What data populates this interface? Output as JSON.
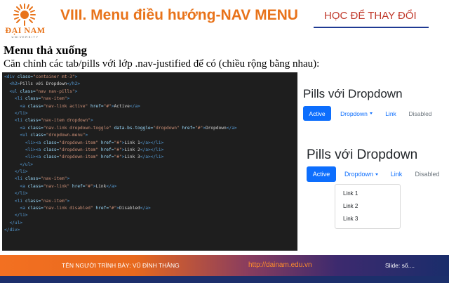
{
  "header": {
    "logo_name": "ĐẠI NAM",
    "logo_sub": "UNIVERSITY",
    "title": "VIII. Menu điều hướng-NAV MENU",
    "right_text": "HỌC ĐỂ THAY ĐỔI"
  },
  "content": {
    "heading": "Menu thả xuống",
    "description": "Căn chỉnh các tab/pills với lớp .nav-justified để có (chiều rộng bằng nhau):"
  },
  "code_lines": [
    [
      [
        "tag",
        "<div "
      ],
      [
        "attr",
        "class="
      ],
      [
        "str",
        "\"container mt-3\""
      ],
      [
        "tag",
        ">"
      ]
    ],
    [
      [
        "txt",
        "  "
      ],
      [
        "tag",
        "<h2>"
      ],
      [
        "txt",
        "Pills với Dropdown"
      ],
      [
        "tag",
        "</h2>"
      ]
    ],
    [
      [
        "txt",
        "  "
      ],
      [
        "tag",
        "<ul "
      ],
      [
        "attr",
        "class="
      ],
      [
        "str",
        "\"nav nav-pills\""
      ],
      [
        "tag",
        ">"
      ]
    ],
    [
      [
        "txt",
        "    "
      ],
      [
        "tag",
        "<li "
      ],
      [
        "attr",
        "class="
      ],
      [
        "str",
        "\"nav-item\""
      ],
      [
        "tag",
        ">"
      ]
    ],
    [
      [
        "txt",
        "      "
      ],
      [
        "tag",
        "<a "
      ],
      [
        "attr",
        "class="
      ],
      [
        "str",
        "\"nav-link active\" "
      ],
      [
        "attr",
        "href="
      ],
      [
        "str",
        "\"#\""
      ],
      [
        "tag",
        ">"
      ],
      [
        "txt",
        "Active"
      ],
      [
        "tag",
        "</a>"
      ]
    ],
    [
      [
        "txt",
        "    "
      ],
      [
        "tag",
        "</li>"
      ]
    ],
    [
      [
        "txt",
        "    "
      ],
      [
        "tag",
        "<li "
      ],
      [
        "attr",
        "class="
      ],
      [
        "str",
        "\"nav-item dropdown\""
      ],
      [
        "tag",
        ">"
      ]
    ],
    [
      [
        "txt",
        "      "
      ],
      [
        "tag",
        "<a "
      ],
      [
        "attr",
        "class="
      ],
      [
        "str",
        "\"nav-link dropdown-toggle\" "
      ],
      [
        "attr",
        "data-bs-toggle="
      ],
      [
        "str",
        "\"dropdown\" "
      ],
      [
        "attr",
        "href="
      ],
      [
        "str",
        "\"#\""
      ],
      [
        "tag",
        ">"
      ],
      [
        "txt",
        "Dropdown"
      ],
      [
        "tag",
        "</a>"
      ]
    ],
    [
      [
        "txt",
        "      "
      ],
      [
        "tag",
        "<ul "
      ],
      [
        "attr",
        "class="
      ],
      [
        "str",
        "\"dropdown-menu\""
      ],
      [
        "tag",
        ">"
      ]
    ],
    [
      [
        "txt",
        "        "
      ],
      [
        "tag",
        "<li><a "
      ],
      [
        "attr",
        "class="
      ],
      [
        "str",
        "\"dropdown-item\" "
      ],
      [
        "attr",
        "href="
      ],
      [
        "str",
        "\"#\""
      ],
      [
        "tag",
        ">"
      ],
      [
        "txt",
        "Link 1"
      ],
      [
        "tag",
        "</a></li>"
      ]
    ],
    [
      [
        "txt",
        "        "
      ],
      [
        "tag",
        "<li><a "
      ],
      [
        "attr",
        "class="
      ],
      [
        "str",
        "\"dropdown-item\" "
      ],
      [
        "attr",
        "href="
      ],
      [
        "str",
        "\"#\""
      ],
      [
        "tag",
        ">"
      ],
      [
        "txt",
        "Link 2"
      ],
      [
        "tag",
        "</a></li>"
      ]
    ],
    [
      [
        "txt",
        "        "
      ],
      [
        "tag",
        "<li><a "
      ],
      [
        "attr",
        "class="
      ],
      [
        "str",
        "\"dropdown-item\" "
      ],
      [
        "attr",
        "href="
      ],
      [
        "str",
        "\"#\""
      ],
      [
        "tag",
        ">"
      ],
      [
        "txt",
        "Link 3"
      ],
      [
        "tag",
        "</a></li>"
      ]
    ],
    [
      [
        "txt",
        "      "
      ],
      [
        "tag",
        "</ul>"
      ]
    ],
    [
      [
        "txt",
        "    "
      ],
      [
        "tag",
        "</li>"
      ]
    ],
    [
      [
        "txt",
        "    "
      ],
      [
        "tag",
        "<li "
      ],
      [
        "attr",
        "class="
      ],
      [
        "str",
        "\"nav-item\""
      ],
      [
        "tag",
        ">"
      ]
    ],
    [
      [
        "txt",
        "      "
      ],
      [
        "tag",
        "<a "
      ],
      [
        "attr",
        "class="
      ],
      [
        "str",
        "\"nav-link\" "
      ],
      [
        "attr",
        "href="
      ],
      [
        "str",
        "\"#\""
      ],
      [
        "tag",
        ">"
      ],
      [
        "txt",
        "Link"
      ],
      [
        "tag",
        "</a>"
      ]
    ],
    [
      [
        "txt",
        "    "
      ],
      [
        "tag",
        "</li>"
      ]
    ],
    [
      [
        "txt",
        "    "
      ],
      [
        "tag",
        "<li "
      ],
      [
        "attr",
        "class="
      ],
      [
        "str",
        "\"nav-item\""
      ],
      [
        "tag",
        ">"
      ]
    ],
    [
      [
        "txt",
        "      "
      ],
      [
        "tag",
        "<a "
      ],
      [
        "attr",
        "class="
      ],
      [
        "str",
        "\"nav-link disabled\" "
      ],
      [
        "attr",
        "href="
      ],
      [
        "str",
        "\"#\""
      ],
      [
        "tag",
        ">"
      ],
      [
        "txt",
        "Disabled"
      ],
      [
        "tag",
        "</a>"
      ]
    ],
    [
      [
        "txt",
        "    "
      ],
      [
        "tag",
        "</li>"
      ]
    ],
    [
      [
        "txt",
        "  "
      ],
      [
        "tag",
        "</ul>"
      ]
    ],
    [
      [
        "tag",
        "</div>"
      ]
    ]
  ],
  "preview1": {
    "title": "Pills với Dropdown",
    "pills": [
      "Active",
      "Dropdown",
      "Link",
      "Disabled"
    ]
  },
  "preview2": {
    "title": "Pills với Dropdown",
    "pills": [
      "Active",
      "Dropdown",
      "Link",
      "Disabled"
    ],
    "dropdown_items": [
      "Link 1",
      "Link 2",
      "Link 3"
    ]
  },
  "footer": {
    "presenter": "TÊN NGƯỜI TRÌNH BÀY: VŨ ĐÌNH THẮNG",
    "url": "http://dainam.edu.vn",
    "slide": "Slide: số...."
  },
  "colors": {
    "accent_orange": "#e8731a",
    "bootstrap_primary": "#0d6efd",
    "footer_navy": "#1c2f6b"
  }
}
